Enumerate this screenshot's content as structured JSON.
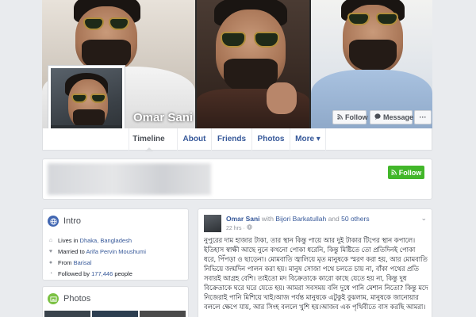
{
  "profile": {
    "name": "Omar Sani"
  },
  "cover_buttons": {
    "follow": "Follow",
    "message": "Message",
    "more": "···"
  },
  "nav": {
    "tabs": [
      {
        "label": "Timeline",
        "active": true
      },
      {
        "label": "About",
        "active": false
      },
      {
        "label": "Friends",
        "active": false
      },
      {
        "label": "Photos",
        "active": false
      },
      {
        "label": "More ▾",
        "active": false
      }
    ]
  },
  "follow_card": {
    "button": "Follow"
  },
  "intro": {
    "title": "Intro",
    "lives_prefix": "Lives in",
    "lives_place": "Dhaka, Bangladesh",
    "married_prefix": "Married to",
    "married_name": "Arifa Pervin Moushumi",
    "from_prefix": "From",
    "from_place": "Barisal",
    "followed_prefix": "Followed by",
    "followed_count": "177,446",
    "followed_suffix": "people"
  },
  "photos": {
    "title": "Photos"
  },
  "post": {
    "author": "Omar Sani",
    "with_word": "with",
    "tagged": "Bijori Barkatullah",
    "and_word": "and",
    "others": "50 others",
    "time": "22 hrs ·",
    "text": "নুপুরের দাম হাজার টাকা, তার স্থান কিন্তু পায়ে আর দুই টাকার টিপের স্থান কপালে। ইতিহাস স্বাক্ষী আছে নুনে কখনো পোকা ধরেনি, কিন্তু মিষ্টিতে তো প্রতিদিনই পোকা ধরে, পিঁপড়া ও ছাড়েনা। মোমবাতি জ্বালিয়ে মৃত মানুষকে স্মরণ করা হয়, আর মোমবাতি নিভিয়ে জন্মদিন পালন করা হয়। মানুষ সোজা পথে চলতে চায় না, বাঁকা পথের প্রতি সবারই আগ্রহ বেশি। তাইতো মদ বিক্রেতাকে কারো কাছে যেতে হয় না, কিন্তু দুধ বিক্রেতাকে ঘরে ঘরে যেতে হয়। আমরা সবসময় বলি দুধে পানি মেশান নিতো? কিন্তু মদে নিজেরাই পানি মিশিয়ে খাই।আজ পর্যন্ত মানুষকে এটুকুই বুঝলাম, মানুষকে জানোয়ার বললে ক্ষেপে যায়, আর সিংহ বললে খুশি হয়।আজব এক পৃথিবীতে বাস করছি আমরা।"
  },
  "colors": {
    "link": "#365899",
    "follow_green": "#42b72a",
    "background": "#e9ebee"
  }
}
